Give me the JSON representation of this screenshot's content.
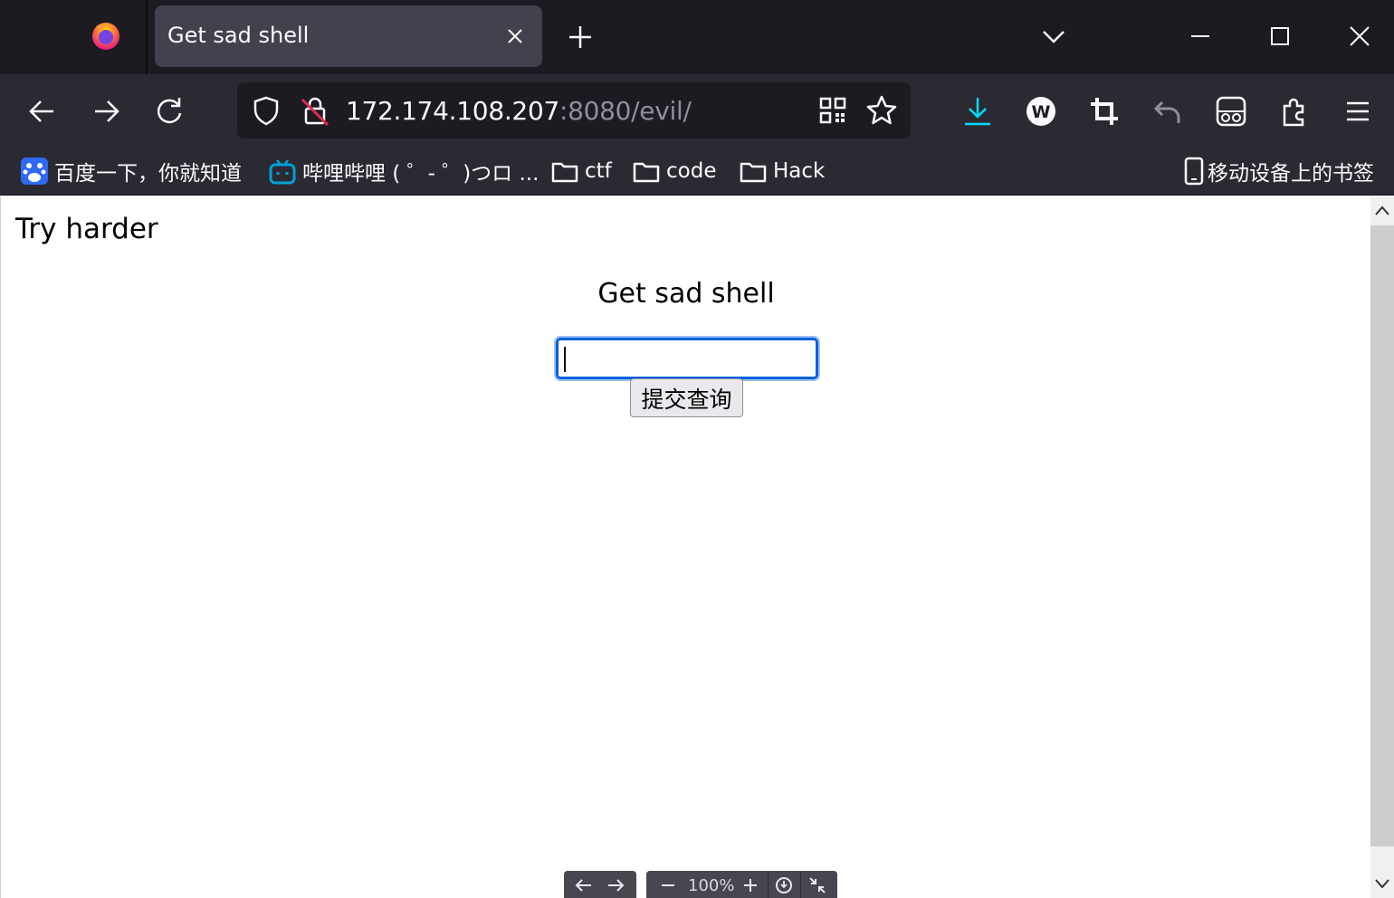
{
  "browser": {
    "tab": {
      "title": "Get sad shell"
    },
    "url": {
      "host": "172.174.108.207",
      "rest": ":8080/evil/"
    }
  },
  "bookmarks": [
    {
      "label": "百度一下，你就知道",
      "icon": "baidu-icon"
    },
    {
      "label": "哔哩哔哩 ( ゜- ゜)つロ ...",
      "icon": "bilibili-icon"
    },
    {
      "label": "ctf",
      "icon": "folder-icon"
    },
    {
      "label": "code",
      "icon": "folder-icon"
    },
    {
      "label": "Hack",
      "icon": "folder-icon"
    }
  ],
  "mobile_bookmarks": {
    "label": "移动设备上的书签",
    "icon": "mobile-icon"
  },
  "page": {
    "message": "Try harder",
    "heading": "Get sad shell",
    "input_value": "",
    "submit_label": "提交查询"
  },
  "bottom_toolbar": {
    "zoom": "100%"
  },
  "colors": {
    "accent": "#0060df",
    "download": "#00ddff",
    "chrome_dark": "#1c1b22"
  }
}
